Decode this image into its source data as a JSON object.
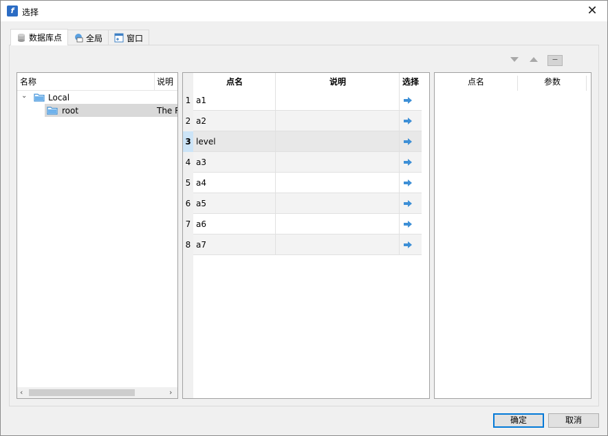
{
  "window": {
    "title": "选择"
  },
  "tabs": [
    {
      "label": "数据库点",
      "icon": "database-icon"
    },
    {
      "label": "全局",
      "icon": "global-icon"
    },
    {
      "label": "窗口",
      "icon": "window-icon"
    }
  ],
  "tree": {
    "columns": [
      "名称",
      "说明"
    ],
    "nodes": [
      {
        "label": "Local",
        "description": "",
        "expanded": true
      },
      {
        "label": "root",
        "description": "The R",
        "selected": true
      }
    ]
  },
  "points_table": {
    "columns": [
      "点名",
      "说明",
      "选择"
    ],
    "rows": [
      {
        "num": "1",
        "name": "a1",
        "desc": ""
      },
      {
        "num": "2",
        "name": "a2",
        "desc": ""
      },
      {
        "num": "3",
        "name": "level",
        "desc": ""
      },
      {
        "num": "4",
        "name": "a3",
        "desc": ""
      },
      {
        "num": "5",
        "name": "a4",
        "desc": ""
      },
      {
        "num": "6",
        "name": "a5",
        "desc": ""
      },
      {
        "num": "7",
        "name": "a6",
        "desc": ""
      },
      {
        "num": "8",
        "name": "a7",
        "desc": ""
      }
    ],
    "selected_row": "3"
  },
  "selected_table": {
    "columns": [
      "点名",
      "参数"
    ]
  },
  "toolbar": {
    "minus_label": "−"
  },
  "buttons": {
    "ok": "确定",
    "cancel": "取消"
  },
  "colors": {
    "accent": "#0078d7",
    "arrow": "#3d8fd6",
    "folder": "#4a9be0",
    "selected_bg": "#d9d9d9"
  }
}
